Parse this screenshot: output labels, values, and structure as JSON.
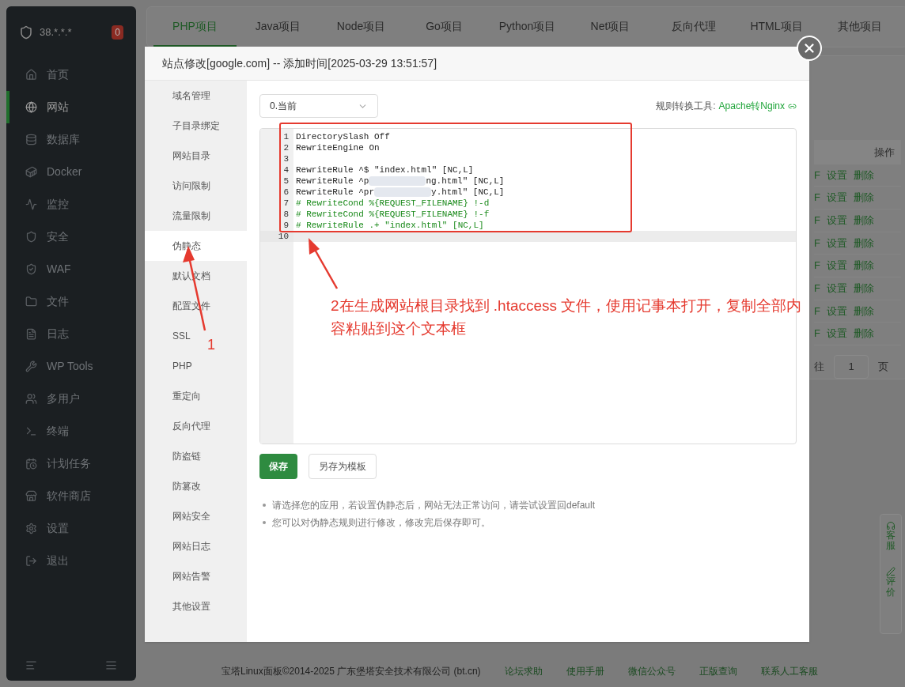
{
  "sidebar": {
    "server": "38.*.*.*",
    "badge": "0",
    "items": [
      {
        "label": "首页",
        "selected": false
      },
      {
        "label": "网站",
        "selected": true
      },
      {
        "label": "数据库",
        "selected": false
      },
      {
        "label": "Docker",
        "selected": false
      },
      {
        "label": "监控",
        "selected": false
      },
      {
        "label": "安全",
        "selected": false
      },
      {
        "label": "WAF",
        "selected": false
      },
      {
        "label": "文件",
        "selected": false
      },
      {
        "label": "日志",
        "selected": false
      },
      {
        "label": "WP Tools",
        "selected": false
      },
      {
        "label": "多用户",
        "selected": false
      },
      {
        "label": "终端",
        "selected": false
      },
      {
        "label": "计划任务",
        "selected": false
      },
      {
        "label": "软件商店",
        "selected": false
      },
      {
        "label": "设置",
        "selected": false
      },
      {
        "label": "退出",
        "selected": false
      }
    ]
  },
  "tabs": [
    {
      "label": "PHP项目",
      "selected": true
    },
    {
      "label": "Java项目",
      "selected": false
    },
    {
      "label": "Node项目",
      "selected": false
    },
    {
      "label": "Go项目",
      "selected": false
    },
    {
      "label": "Python项目",
      "selected": false
    },
    {
      "label": "Net项目",
      "selected": false
    },
    {
      "label": "反向代理",
      "selected": false
    },
    {
      "label": "HTML项目",
      "selected": false
    },
    {
      "label": "其他项目",
      "selected": false
    }
  ],
  "table": {
    "column_header": "操作",
    "rows": [
      {
        "cell_1": "F",
        "cell_2": "设置",
        "cell_3": "删除"
      },
      {
        "cell_1": "F",
        "cell_2": "设置",
        "cell_3": "删除"
      },
      {
        "cell_1": "F",
        "cell_2": "设置",
        "cell_3": "删除"
      },
      {
        "cell_1": "F",
        "cell_2": "设置",
        "cell_3": "删除"
      },
      {
        "cell_1": "F",
        "cell_2": "设置",
        "cell_3": "删除"
      },
      {
        "cell_1": "F",
        "cell_2": "设置",
        "cell_3": "删除"
      },
      {
        "cell_1": "F",
        "cell_2": "设置",
        "cell_3": "删除"
      },
      {
        "cell_1": "F",
        "cell_2": "设置",
        "cell_3": "删除"
      }
    ],
    "pagination": {
      "prefix": "往",
      "page": "1",
      "suffix": "页"
    }
  },
  "float_widget": [
    "客服",
    "评价"
  ],
  "dialog": {
    "title": "站点修改[google.com] -- 添加时间[2025-03-29 13:51:57]",
    "nav": [
      {
        "label": "域名管理",
        "selected": false
      },
      {
        "label": "子目录绑定",
        "selected": false
      },
      {
        "label": "网站目录",
        "selected": false
      },
      {
        "label": "访问限制",
        "selected": false
      },
      {
        "label": "流量限制",
        "selected": false
      },
      {
        "label": "伪静态",
        "selected": true
      },
      {
        "label": "默认文档",
        "selected": false
      },
      {
        "label": "配置文件",
        "selected": false
      },
      {
        "label": "SSL",
        "selected": false
      },
      {
        "label": "PHP",
        "selected": false
      },
      {
        "label": "重定向",
        "selected": false
      },
      {
        "label": "反向代理",
        "selected": false
      },
      {
        "label": "防盗链",
        "selected": false
      },
      {
        "label": "防篡改",
        "selected": false
      },
      {
        "label": "网站安全",
        "selected": false
      },
      {
        "label": "网站日志",
        "selected": false
      },
      {
        "label": "网站告警",
        "selected": false
      },
      {
        "label": "其他设置",
        "selected": false
      }
    ],
    "template_select": "0.当前",
    "tool_label": "规则转换工具:",
    "tool_link": "Apache转Nginx",
    "code_lines": [
      {
        "number": "1",
        "kind": "code",
        "text": "DirectorySlash Off"
      },
      {
        "number": "2",
        "kind": "code",
        "text": "RewriteEngine On"
      },
      {
        "number": "3",
        "kind": "code"
      },
      {
        "number": "4",
        "kind": "code",
        "text": "RewriteRule ^$ \"index.html\" [NC,L]"
      },
      {
        "number": "5",
        "kind": "smudged",
        "text": "RewriteRule ^p",
        "text_after": "ng.html\" [NC,L]"
      },
      {
        "number": "6",
        "kind": "smudged",
        "text": "RewriteRule ^pr",
        "text_after": "y.html\" [NC,L]"
      },
      {
        "number": "7",
        "kind": "comment",
        "text": "# RewriteCond %{REQUEST_FILENAME} !-d"
      },
      {
        "number": "8",
        "kind": "comment",
        "text": "# RewriteCond %{REQUEST_FILENAME} !-f"
      },
      {
        "number": "9",
        "kind": "comment",
        "text": "# RewriteRule .+ \"index.html\" [NC,L]"
      },
      {
        "number": "10",
        "kind": "active"
      }
    ],
    "buttons": [
      "保存",
      "另存为模板"
    ],
    "notes": [
      "请选择您的应用，若设置伪静态后，网站无法正常访问，请尝试设置回default",
      "您可以对伪静态规则进行修改，修改完后保存即可。"
    ]
  },
  "annotations": [
    {
      "kind": "step",
      "text": "1"
    },
    {
      "kind": "step",
      "text": "2在生成网站根目录找到 .htaccess 文件，使用记事本打开，复制全部内容粘贴到这个文本框"
    }
  ],
  "footer": {
    "copyright": "宝塔Linux面板©2014-2025 广东堡塔安全技术有限公司 (bt.cn)",
    "links": [
      "论坛求助",
      "使用手册",
      "微信公众号",
      "正版查询",
      "联系人工客服"
    ]
  }
}
